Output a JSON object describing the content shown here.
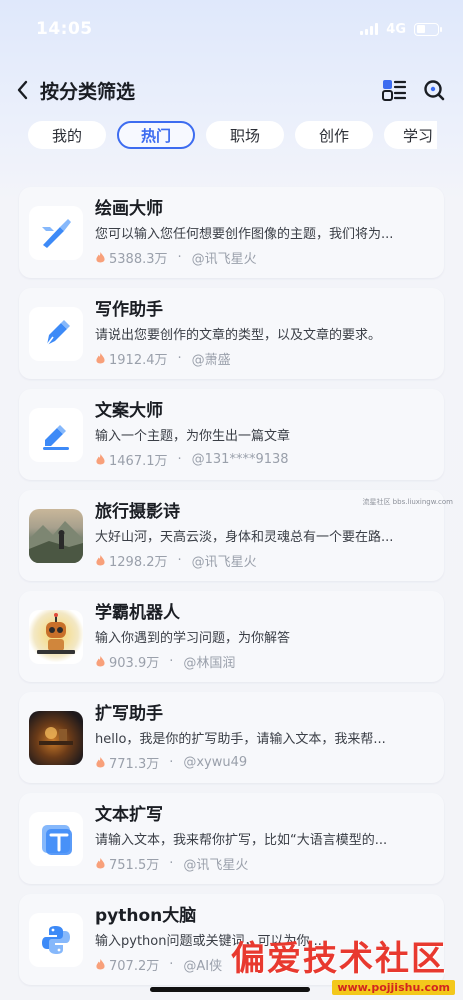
{
  "status_bar": {
    "time": "14:05",
    "network": "4G",
    "battery_level": 0.4
  },
  "nav": {
    "title": "按分类筛选",
    "icons": [
      "back-chevron-icon",
      "list-grid-icon",
      "search-icon"
    ]
  },
  "tabs": [
    {
      "label": "我的",
      "active": false
    },
    {
      "label": "热门",
      "active": true
    },
    {
      "label": "职场",
      "active": false
    },
    {
      "label": "创作",
      "active": false
    },
    {
      "label": "学习",
      "active": false
    }
  ],
  "cards": [
    {
      "title": "绘画大师",
      "desc": "您可以输入您任何想要创作图像的主题，我们将为...",
      "count": "5388.3万",
      "author": "@讯飞星火",
      "icon": "paintbrush-icon"
    },
    {
      "title": "写作助手",
      "desc": "请说出您要创作的文章的类型，以及文章的要求。",
      "count": "1912.4万",
      "author": "@萧盛",
      "icon": "pen-nib-icon"
    },
    {
      "title": "文案大师",
      "desc": "输入一个主题，为你生出一篇文章",
      "count": "1467.1万",
      "author": "@131****9138",
      "icon": "edit-doc-icon"
    },
    {
      "title": "旅行摄影诗",
      "desc": "大好山河，天高云淡，身体和灵魂总有一个要在路...",
      "count": "1298.2万",
      "author": "@讯飞星火",
      "icon": "travel-photo-thumbnail"
    },
    {
      "title": "学霸机器人",
      "desc": "输入你遇到的学习问题，为你解答",
      "count": "903.9万",
      "author": "@林国润",
      "icon": "robot-thumbnail"
    },
    {
      "title": "扩写助手",
      "desc": "hello，我是你的扩写助手，请输入文本，我来帮...",
      "count": "771.3万",
      "author": "@xywu49",
      "icon": "expand-writer-thumbnail"
    },
    {
      "title": "文本扩写",
      "desc": "请输入文本，我来帮你扩写，比如“大语言模型的...",
      "count": "751.5万",
      "author": "@讯飞星火",
      "icon": "text-t-icon"
    },
    {
      "title": "python大脑",
      "desc": "输入python问题或关键词，可以为你...",
      "count": "707.2万",
      "author": "@AI侠",
      "icon": "python-icon"
    }
  ],
  "watermark": {
    "text": "偏爱技术社区",
    "url": "www.pojjishu.com",
    "small": "流星社区 bbs.liuxingw.com"
  }
}
